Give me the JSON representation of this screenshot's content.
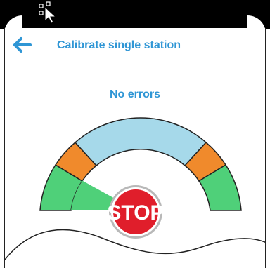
{
  "header": {
    "title": "Calibrate single station",
    "back_icon": "arrow-left-icon"
  },
  "status": {
    "text": "No errors"
  },
  "gauge": {
    "level": 0.08,
    "stop_label": "STOP",
    "colors": {
      "green": "#4fd079",
      "orange": "#f08a2c",
      "blue": "#a6d9ea",
      "stop_red": "#e01e2b",
      "accent": "#2f96d5"
    }
  }
}
